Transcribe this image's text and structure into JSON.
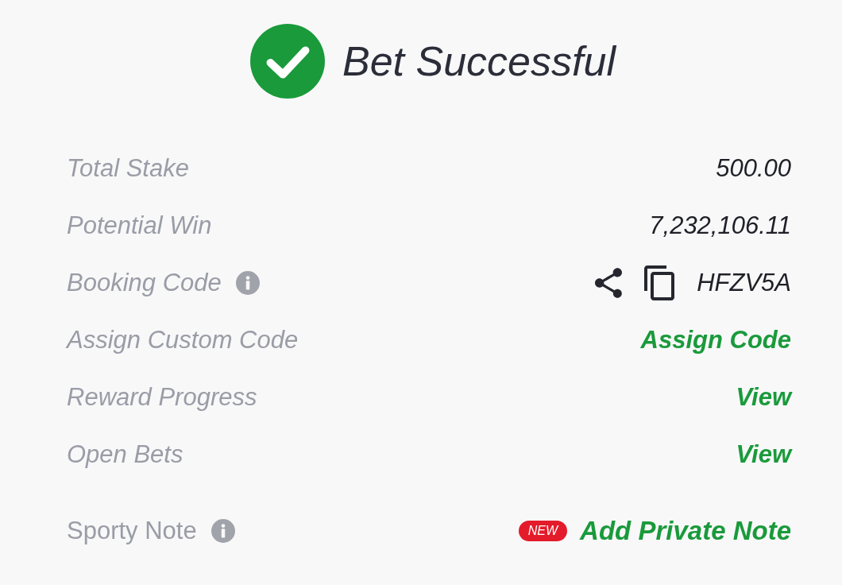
{
  "header": {
    "title": "Bet Successful"
  },
  "summary": [
    {
      "label": "Total Stake",
      "info": false,
      "kind": "amount",
      "value": "500.00"
    },
    {
      "label": "Potential Win",
      "info": false,
      "kind": "amount",
      "value": "7,232,106.11"
    },
    {
      "label": "Booking Code",
      "info": true,
      "kind": "code",
      "value": "HFZV5A"
    },
    {
      "label": "Assign Custom Code",
      "info": false,
      "kind": "link",
      "value": "Assign Code"
    },
    {
      "label": "Reward Progress",
      "info": false,
      "kind": "link",
      "value": "View"
    },
    {
      "label": "Open Bets",
      "info": false,
      "kind": "link",
      "value": "View"
    }
  ],
  "note": {
    "label": "Sporty Note",
    "info": true,
    "badge": "NEW",
    "value": "Add Private Note"
  }
}
